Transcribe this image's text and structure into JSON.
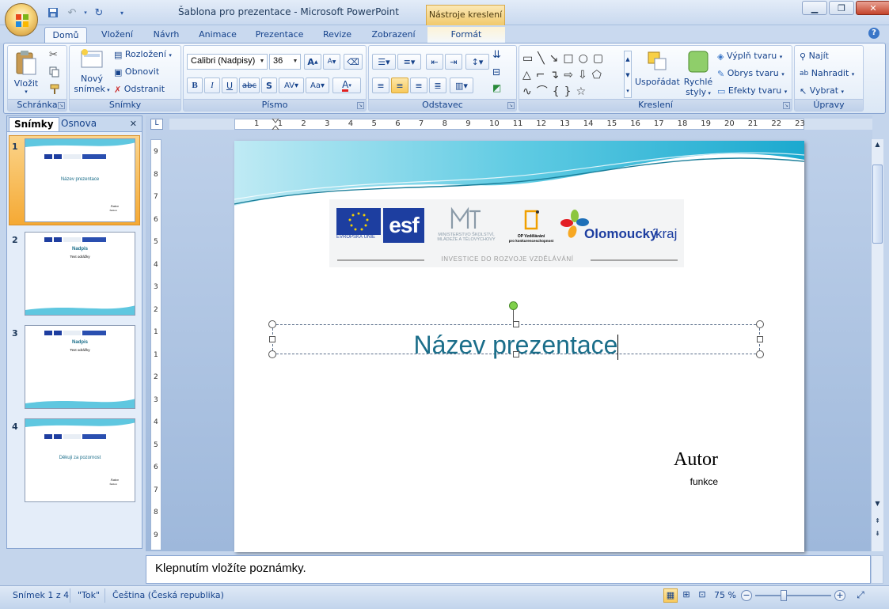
{
  "window": {
    "title": "Šablona pro prezentace - Microsoft PowerPoint",
    "context_tab_title": "Nástroje kreslení"
  },
  "tabs": [
    "Domů",
    "Vložení",
    "Návrh",
    "Animace",
    "Prezentace",
    "Revize",
    "Zobrazení",
    "Formát"
  ],
  "ribbon": {
    "clipboard": {
      "label": "Schránka",
      "paste": "Vložit"
    },
    "slides": {
      "label": "Snímky",
      "new_slide_1": "Nový",
      "new_slide_2": "snímek",
      "layout": "Rozložení",
      "reset": "Obnovit",
      "delete": "Odstranit"
    },
    "font": {
      "label": "Písmo",
      "font_name": "Calibri (Nadpisy)",
      "font_size": "36"
    },
    "paragraph": {
      "label": "Odstavec"
    },
    "drawing": {
      "label": "Kreslení",
      "arrange": "Uspořádat",
      "quick_styles_1": "Rychlé",
      "quick_styles_2": "styly",
      "fill": "Výplň tvaru",
      "outline": "Obrys tvaru",
      "effects": "Efekty tvaru"
    },
    "editing": {
      "label": "Úpravy",
      "find": "Najít",
      "replace": "Nahradit",
      "select": "Vybrat"
    }
  },
  "pane": {
    "tab_slides": "Snímky",
    "tab_outline": "Osnova",
    "thumbnails": [
      {
        "num": "1",
        "title": "Název prezentace",
        "author": "Autor",
        "role": "funkce"
      },
      {
        "num": "2",
        "title": "Nadpis",
        "subtitle": "Text odrážky"
      },
      {
        "num": "3",
        "title": "Nadpis",
        "subtitle": "Text odrážky"
      },
      {
        "num": "4",
        "title": "Děkuji za pozornost",
        "author": "Autor",
        "role": "funkce"
      }
    ]
  },
  "slide": {
    "title": "Název prezentace",
    "author": "Autor",
    "role": "funkce",
    "logo_texts": {
      "eu": "EVROPSKÁ UNIE",
      "esf": "esf",
      "msmt_1": "MINISTERSTVO ŠKOLSTVÍ,",
      "msmt_2": "MLÁDEŽE A TĚLOVÝCHOVY",
      "op_1": "OP Vzdělávání",
      "op_2": "pro konkurenceschopnost",
      "olomouc_1": "Olomoucký",
      "olomouc_2": "kraj",
      "invest": "INVESTICE DO ROZVOJE VZDĚLÁVÁNÍ"
    }
  },
  "ruler": {
    "h_labels": [
      "1",
      "1",
      "2",
      "3",
      "4",
      "5",
      "6",
      "7",
      "8",
      "9",
      "10",
      "11",
      "12",
      "13",
      "14",
      "15",
      "16",
      "17",
      "18",
      "19",
      "20",
      "21",
      "22",
      "23"
    ],
    "v_labels": [
      "9",
      "8",
      "7",
      "6",
      "5",
      "4",
      "3",
      "2",
      "1",
      "1",
      "2",
      "3",
      "4",
      "5",
      "6",
      "7",
      "8",
      "9"
    ]
  },
  "notes": {
    "placeholder": "Klepnutím vložíte poznámky."
  },
  "status": {
    "slide": "Snímek 1 z 4",
    "theme": "\"Tok\"",
    "language": "Čeština (Česká republika)",
    "zoom": "75 %"
  },
  "colors": {
    "title_teal": "#1b6e8a",
    "accent": "#f5a934"
  }
}
